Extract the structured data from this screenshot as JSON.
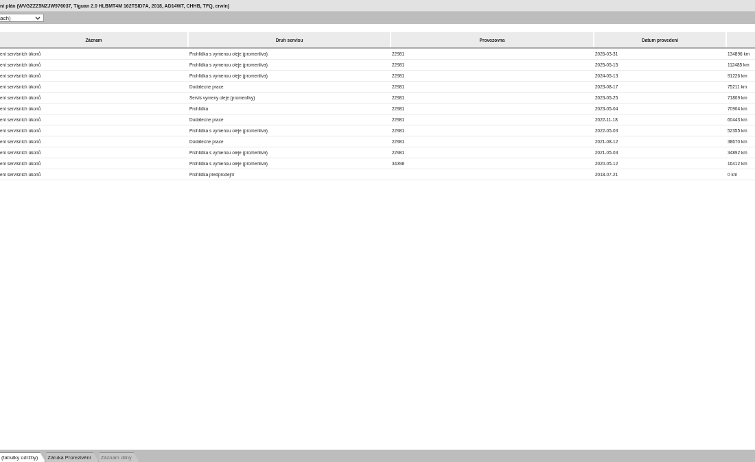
{
  "window": {
    "title": "ní plán (WVGZZZ5NZJW976037, Tiguan 2.0 HLBMT4M 162TSID7A, 2018, AD14WT, CHHB, TFQ, erwin)"
  },
  "filter": {
    "value": "ach)"
  },
  "table": {
    "columns": [
      "Záznam",
      "Druh servisu",
      "Provozovna",
      "Datum provedení",
      ""
    ],
    "rows": [
      {
        "record": "ení servisnich úkonů",
        "service_type": "Prohlidka s vymenou oleje (promenliva)",
        "workshop": "22981",
        "date": "2026-03-31",
        "column_5": "134896 km"
      },
      {
        "record": "ení servisnich úkonů",
        "service_type": "Prohlidka s vymenou oleje (promenliva)",
        "workshop": "22981",
        "date": "2025-05-15",
        "column_5": "112485 km"
      },
      {
        "record": "ení servisnich úkonů",
        "service_type": "Prohlidka s vymenou oleje (promenliva)",
        "workshop": "22981",
        "date": "2024-05-13",
        "column_5": "91226 km"
      },
      {
        "record": "ení servisnich úkonů",
        "service_type": "Dodatecne prace",
        "workshop": "22981",
        "date": "2023-08-17",
        "column_5": "75211 km"
      },
      {
        "record": "ení servisnich úkonů",
        "service_type": "Servis vymeny oleje (promenlivy)",
        "workshop": "22981",
        "date": "2023-05-25",
        "column_5": "71809 km"
      },
      {
        "record": "ení servisnich úkonů",
        "service_type": "Prohlidka",
        "workshop": "22981",
        "date": "2023-05-04",
        "column_5": "70904 km"
      },
      {
        "record": "ení servisnich úkonů",
        "service_type": "Dodatecne prace",
        "workshop": "22981",
        "date": "2022-11-18",
        "column_5": "60443 km"
      },
      {
        "record": "ení servisnich úkonů",
        "service_type": "Prohlidka s vymenou oleje (promenliva)",
        "workshop": "22981",
        "date": "2022-05-03",
        "column_5": "52355 km"
      },
      {
        "record": "ení servisnich úkonů",
        "service_type": "Dodatecne prace",
        "workshop": "22981",
        "date": "2021-08-12",
        "column_5": "38670 km"
      },
      {
        "record": "ení servisnich úkonů",
        "service_type": "Prohlidka s vymenou oleje (promenliva)",
        "workshop": "22981",
        "date": "2021-05-03",
        "column_5": "34892 km"
      },
      {
        "record": "ení servisnich úkonů",
        "service_type": "Prohlidka s vymenou oleje (promenliva)",
        "workshop": "34398",
        "date": "2020-05-12",
        "column_5": "16412 km"
      },
      {
        "record": "ení servisnich úkonů",
        "service_type": "Prohlidka predprodejni",
        "date": "2018-07-21",
        "column_5": "0 km"
      }
    ]
  },
  "tabs": [
    {
      "label": "(tabulky údržby)",
      "selected": true,
      "disabled": false
    },
    {
      "label": "Záruka Prorezivění",
      "selected": false,
      "disabled": false
    },
    {
      "label": "Záznam dílny",
      "selected": false,
      "disabled": true
    }
  ]
}
